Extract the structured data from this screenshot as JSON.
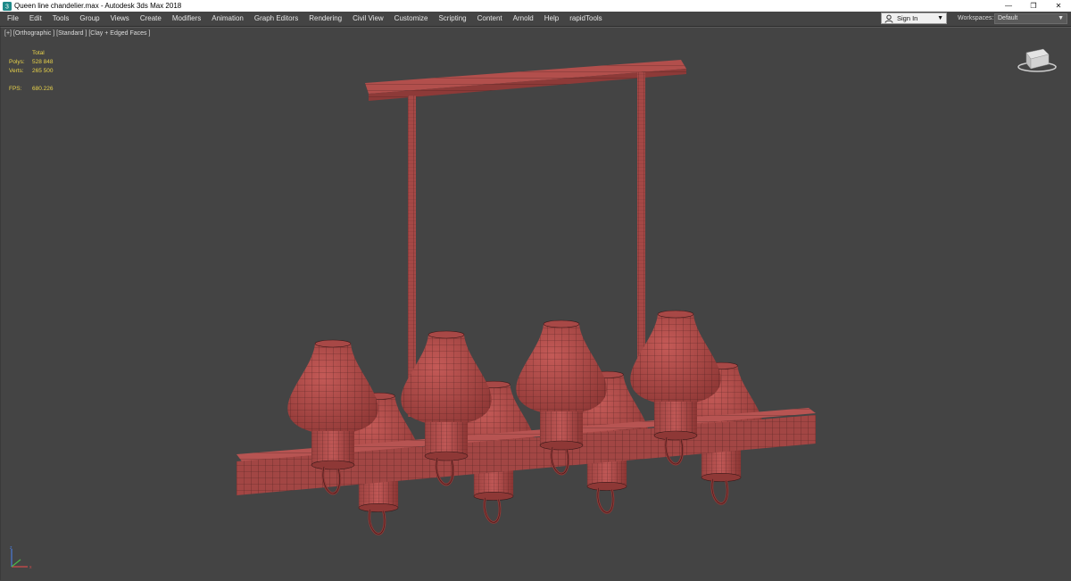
{
  "titlebar": {
    "title": "Queen line chandelier.max - Autodesk 3ds Max 2018",
    "controls": [
      "—",
      "❐",
      "✕"
    ]
  },
  "menu": [
    "File",
    "Edit",
    "Tools",
    "Group",
    "Views",
    "Create",
    "Modifiers",
    "Animation",
    "Graph Editors",
    "Rendering",
    "Civil View",
    "Customize",
    "Scripting",
    "Content",
    "Arnold",
    "Help",
    "rapidTools"
  ],
  "account": {
    "signin_label": "Sign In",
    "workspaces_label": "Workspaces:",
    "workspace_value": "Default"
  },
  "viewport": {
    "labels": "[+] [Orthographic ] [Standard ] [Clay + Edged Faces ]",
    "stats": {
      "header": "Total",
      "polys_label": "Polys:",
      "polys_value": "528 848",
      "verts_label": "Verts:",
      "verts_value": "265 500",
      "fps_label": "FPS:",
      "fps_value": "680.226"
    }
  },
  "colors": {
    "clay": "#b24f4c",
    "clay_dark": "#7a2e2d",
    "wire": "#3a1818",
    "viewport_bg": "#444444",
    "stats_text": "#e8d24a"
  },
  "icons": {
    "app": "3ds-max-icon",
    "user": "user-icon",
    "viewcube": "viewcube-icon",
    "axis": "axis-gizmo-icon"
  }
}
